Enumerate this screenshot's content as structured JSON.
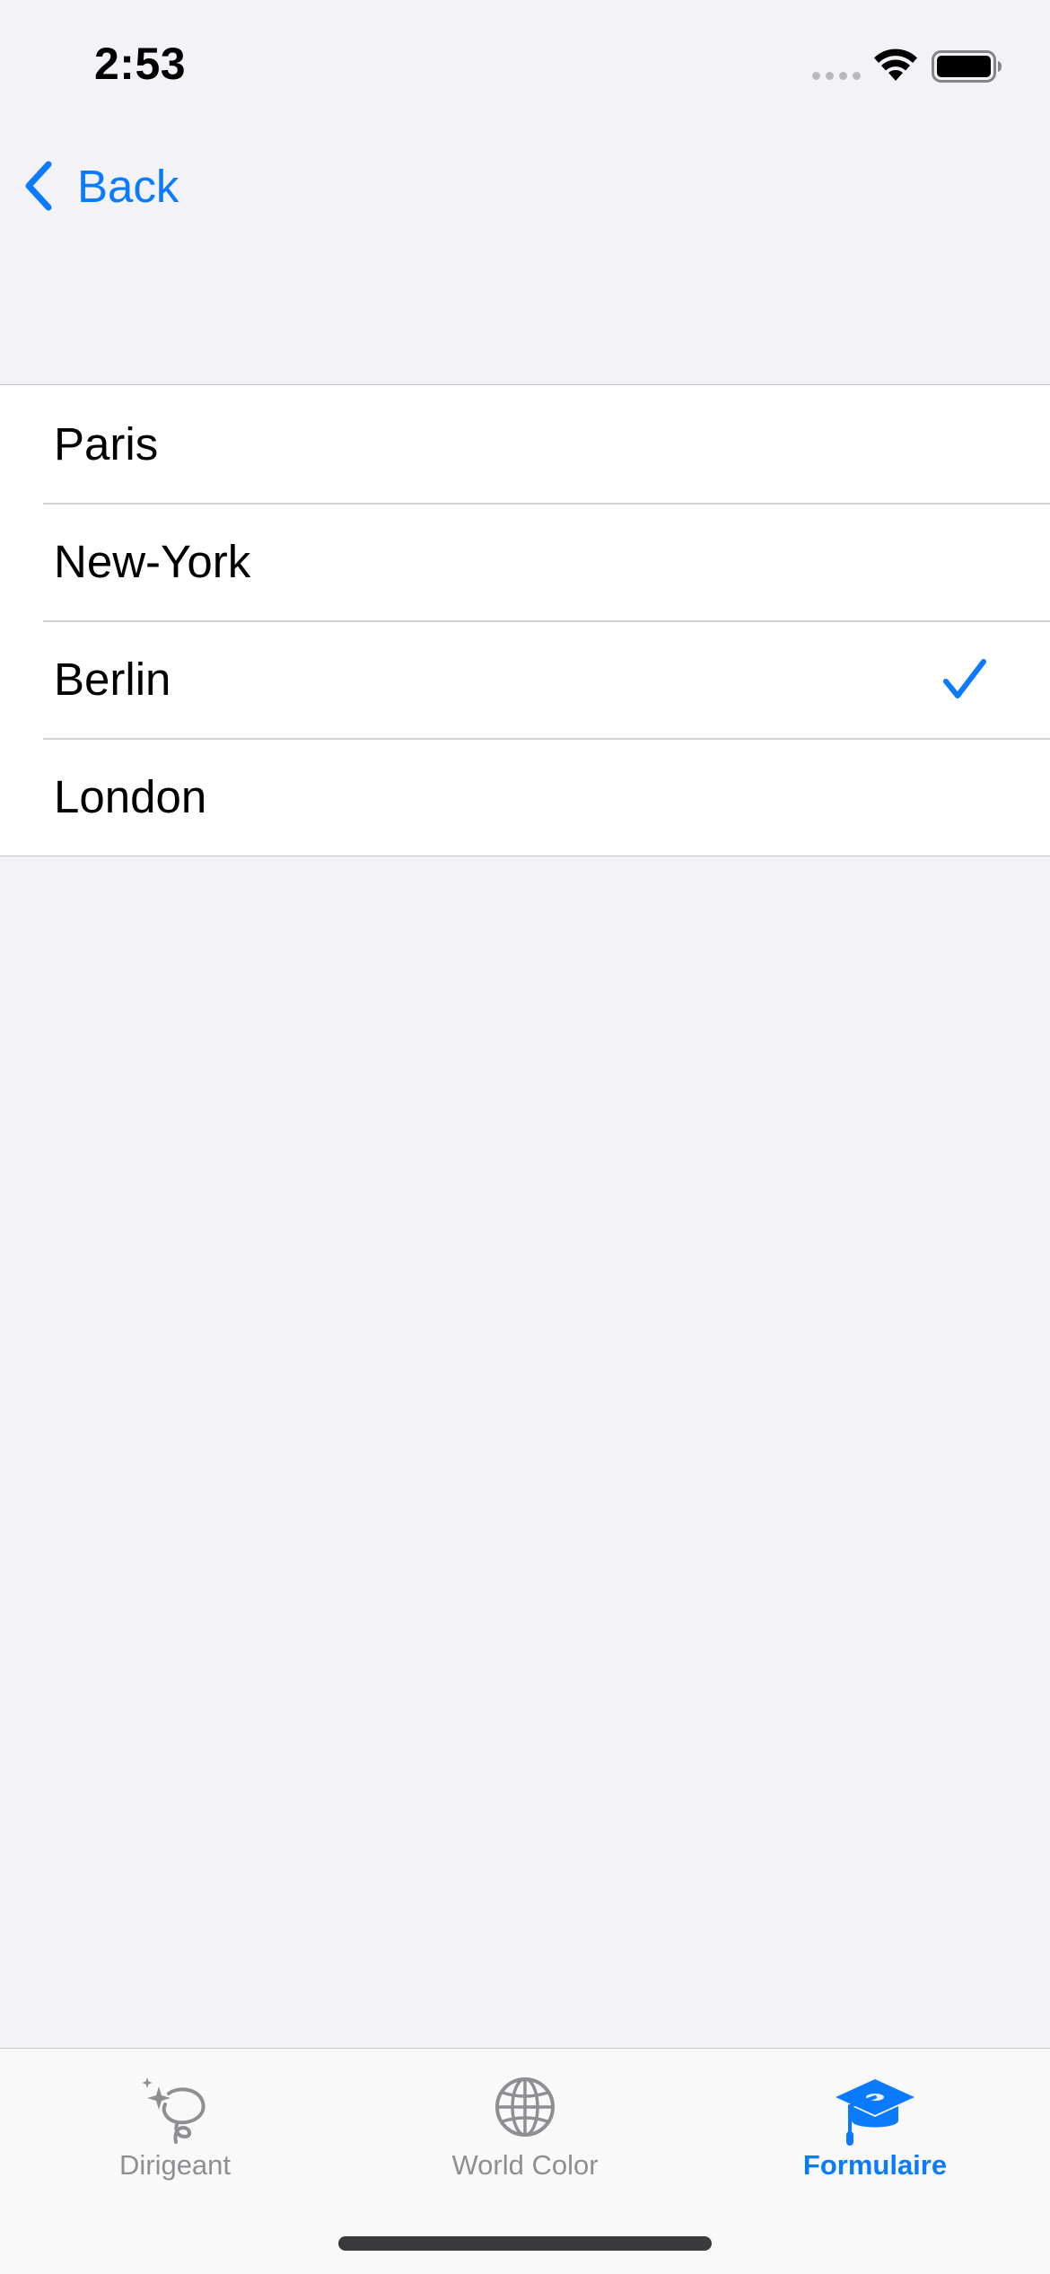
{
  "status_bar": {
    "time": "2:53"
  },
  "nav": {
    "back_label": "Back"
  },
  "list": {
    "items": [
      {
        "label": "Paris",
        "selected": false
      },
      {
        "label": "New-York",
        "selected": false
      },
      {
        "label": "Berlin",
        "selected": true
      },
      {
        "label": "London",
        "selected": false
      }
    ]
  },
  "tab_bar": {
    "tabs": [
      {
        "label": "Dirigeant",
        "icon": "sparkles-lasso-icon",
        "active": false
      },
      {
        "label": "World Color",
        "icon": "globe-icon",
        "active": false
      },
      {
        "label": "Formulaire",
        "icon": "graduation-cap-icon",
        "active": true
      }
    ]
  },
  "colors": {
    "accent": "#0A7AFF",
    "background": "#F2F2F7",
    "inactive_tab": "#8E8E93"
  }
}
